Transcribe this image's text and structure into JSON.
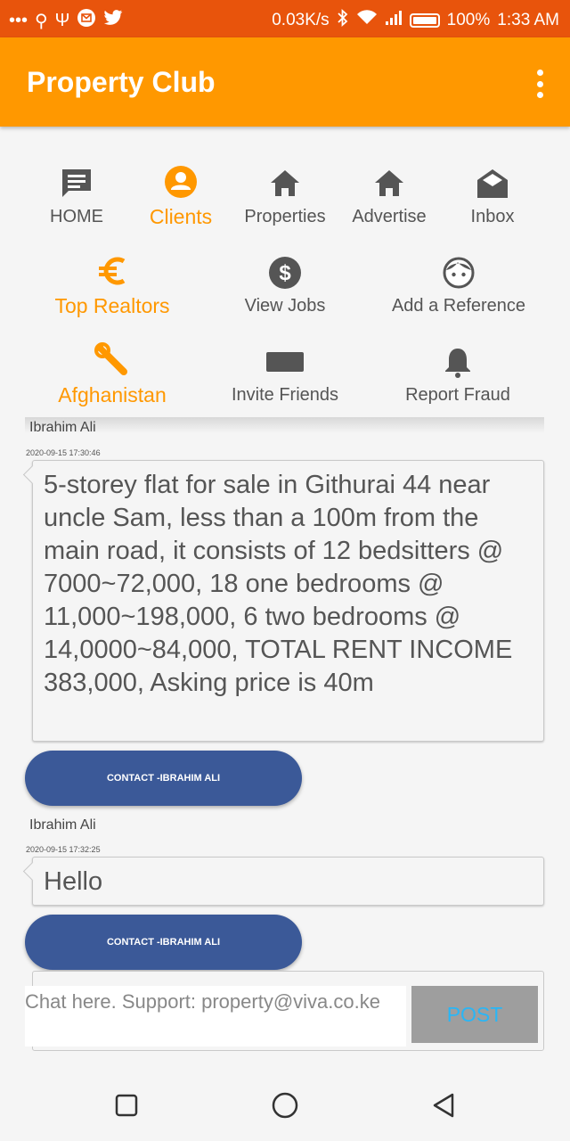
{
  "status": {
    "speed": "0.03K/s",
    "battery": "100%",
    "time": "1:33 AM",
    "left_icons": [
      "more-icon",
      "usb-icon",
      "usb-icon",
      "mail-icon",
      "twitter-icon"
    ],
    "right_icons": [
      "bluetooth-icon",
      "wifi-icon",
      "signal-icon",
      "battery-icon"
    ]
  },
  "appbar": {
    "title": "Property Club",
    "menu_icon": "overflow-menu-icon"
  },
  "nav": {
    "home": "HOME",
    "clients": "Clients",
    "properties": "Properties",
    "advertise": "Advertise",
    "inbox": "Inbox",
    "top_realtors": "Top Realtors",
    "view_jobs": "View Jobs",
    "add_reference": "Add a Reference",
    "country": "Afghanistan",
    "invite_friends": "Invite Friends",
    "report_fraud": "Report Fraud"
  },
  "posts": [
    {
      "author": "Ibrahim Ali",
      "time": "2020-09-15 17:30:46",
      "text": "5-storey flat for sale in Githurai 44 near uncle Sam, less than a 100m from the main road, it consists of 12 bedsitters @ 7000~72,000, 18 one bedrooms @ 11,000~198,000,  6 two bedrooms @ 14,0000~84,000, TOTAL RENT INCOME 383,000, Asking price is 40m",
      "contact_label": "CONTACT -IBRAHIM ALI"
    },
    {
      "author": "Ibrahim Ali",
      "time": "2020-09-15 17:32:25",
      "text": "Hello",
      "contact_label": "CONTACT -IBRAHIM ALI"
    }
  ],
  "composer": {
    "placeholder": "Chat here. Support: property@viva.co.ke",
    "post_label": "POST"
  },
  "colors": {
    "status_bar": "#e8540c",
    "app_bar": "#ff9800",
    "accent": "#ff9800",
    "contact_button": "#3b5998",
    "post_text": "#29b6f6"
  },
  "system_nav": [
    "recents-icon",
    "home-circle-icon",
    "back-icon"
  ]
}
